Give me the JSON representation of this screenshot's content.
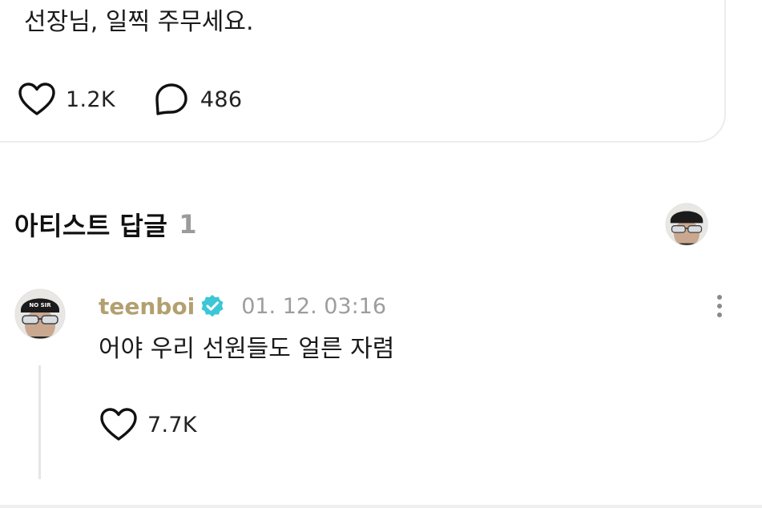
{
  "post": {
    "text": "선장님, 일찍 주무세요.",
    "likes": "1.2K",
    "comments": "486",
    "like_icon": "heart-outline-icon",
    "comment_icon": "speech-bubble-icon"
  },
  "artist_replies": {
    "title": "아티스트 답글",
    "count": "1",
    "avatar_icon": "artist-avatar"
  },
  "reply": {
    "author": "teenboi",
    "verified_icon": "verified-badge-icon",
    "timestamp": "01. 12. 03:16",
    "text": "어야 우리 선원들도 얼른 자렴",
    "likes": "7.7K",
    "cap_text": "NO SIR",
    "more_icon": "more-vertical-icon"
  },
  "colors": {
    "author": "#b3a070",
    "verified": "#3cc6d6",
    "muted": "#9d9d9d",
    "border": "#ececec"
  }
}
